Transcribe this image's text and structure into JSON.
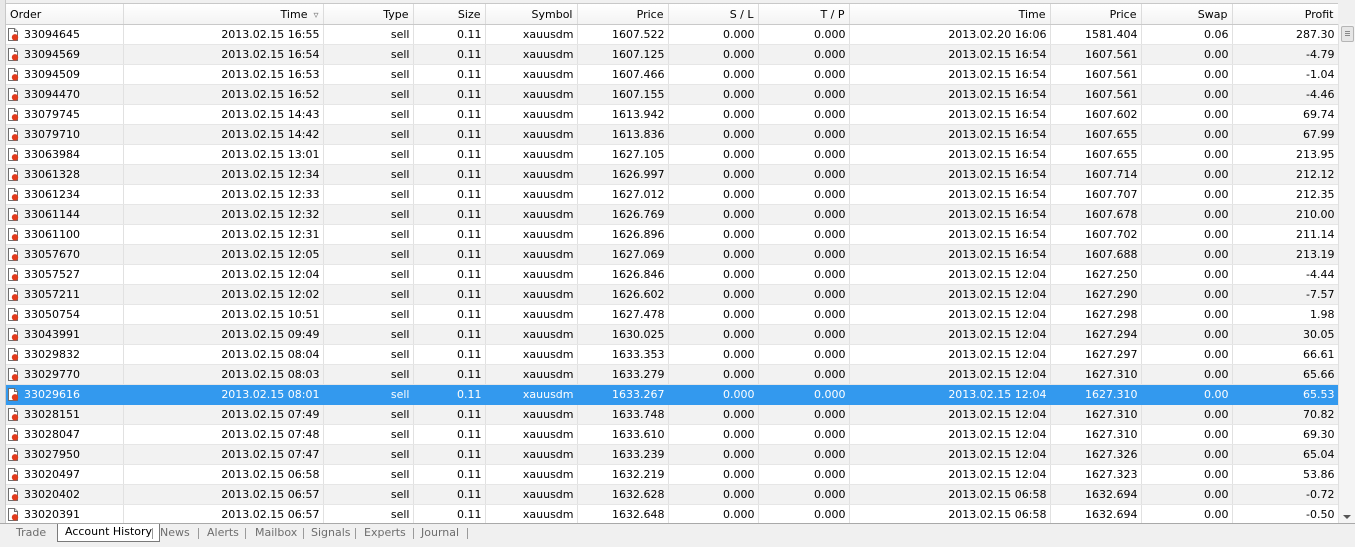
{
  "columns": [
    "Order",
    "Time",
    "Type",
    "Size",
    "Symbol",
    "Price",
    "S / L",
    "T / P",
    "Time",
    "Price",
    "Swap",
    "Profit"
  ],
  "sort_column": "Time",
  "selected_order": "33029616",
  "rows": [
    [
      "33094645",
      "2013.02.15 16:55",
      "sell",
      "0.11",
      "xauusdm",
      "1607.522",
      "0.000",
      "0.000",
      "2013.02.20 16:06",
      "1581.404",
      "0.06",
      "287.30"
    ],
    [
      "33094569",
      "2013.02.15 16:54",
      "sell",
      "0.11",
      "xauusdm",
      "1607.125",
      "0.000",
      "0.000",
      "2013.02.15 16:54",
      "1607.561",
      "0.00",
      "-4.79"
    ],
    [
      "33094509",
      "2013.02.15 16:53",
      "sell",
      "0.11",
      "xauusdm",
      "1607.466",
      "0.000",
      "0.000",
      "2013.02.15 16:54",
      "1607.561",
      "0.00",
      "-1.04"
    ],
    [
      "33094470",
      "2013.02.15 16:52",
      "sell",
      "0.11",
      "xauusdm",
      "1607.155",
      "0.000",
      "0.000",
      "2013.02.15 16:54",
      "1607.561",
      "0.00",
      "-4.46"
    ],
    [
      "33079745",
      "2013.02.15 14:43",
      "sell",
      "0.11",
      "xauusdm",
      "1613.942",
      "0.000",
      "0.000",
      "2013.02.15 16:54",
      "1607.602",
      "0.00",
      "69.74"
    ],
    [
      "33079710",
      "2013.02.15 14:42",
      "sell",
      "0.11",
      "xauusdm",
      "1613.836",
      "0.000",
      "0.000",
      "2013.02.15 16:54",
      "1607.655",
      "0.00",
      "67.99"
    ],
    [
      "33063984",
      "2013.02.15 13:01",
      "sell",
      "0.11",
      "xauusdm",
      "1627.105",
      "0.000",
      "0.000",
      "2013.02.15 16:54",
      "1607.655",
      "0.00",
      "213.95"
    ],
    [
      "33061328",
      "2013.02.15 12:34",
      "sell",
      "0.11",
      "xauusdm",
      "1626.997",
      "0.000",
      "0.000",
      "2013.02.15 16:54",
      "1607.714",
      "0.00",
      "212.12"
    ],
    [
      "33061234",
      "2013.02.15 12:33",
      "sell",
      "0.11",
      "xauusdm",
      "1627.012",
      "0.000",
      "0.000",
      "2013.02.15 16:54",
      "1607.707",
      "0.00",
      "212.35"
    ],
    [
      "33061144",
      "2013.02.15 12:32",
      "sell",
      "0.11",
      "xauusdm",
      "1626.769",
      "0.000",
      "0.000",
      "2013.02.15 16:54",
      "1607.678",
      "0.00",
      "210.00"
    ],
    [
      "33061100",
      "2013.02.15 12:31",
      "sell",
      "0.11",
      "xauusdm",
      "1626.896",
      "0.000",
      "0.000",
      "2013.02.15 16:54",
      "1607.702",
      "0.00",
      "211.14"
    ],
    [
      "33057670",
      "2013.02.15 12:05",
      "sell",
      "0.11",
      "xauusdm",
      "1627.069",
      "0.000",
      "0.000",
      "2013.02.15 16:54",
      "1607.688",
      "0.00",
      "213.19"
    ],
    [
      "33057527",
      "2013.02.15 12:04",
      "sell",
      "0.11",
      "xauusdm",
      "1626.846",
      "0.000",
      "0.000",
      "2013.02.15 12:04",
      "1627.250",
      "0.00",
      "-4.44"
    ],
    [
      "33057211",
      "2013.02.15 12:02",
      "sell",
      "0.11",
      "xauusdm",
      "1626.602",
      "0.000",
      "0.000",
      "2013.02.15 12:04",
      "1627.290",
      "0.00",
      "-7.57"
    ],
    [
      "33050754",
      "2013.02.15 10:51",
      "sell",
      "0.11",
      "xauusdm",
      "1627.478",
      "0.000",
      "0.000",
      "2013.02.15 12:04",
      "1627.298",
      "0.00",
      "1.98"
    ],
    [
      "33043991",
      "2013.02.15 09:49",
      "sell",
      "0.11",
      "xauusdm",
      "1630.025",
      "0.000",
      "0.000",
      "2013.02.15 12:04",
      "1627.294",
      "0.00",
      "30.05"
    ],
    [
      "33029832",
      "2013.02.15 08:04",
      "sell",
      "0.11",
      "xauusdm",
      "1633.353",
      "0.000",
      "0.000",
      "2013.02.15 12:04",
      "1627.297",
      "0.00",
      "66.61"
    ],
    [
      "33029770",
      "2013.02.15 08:03",
      "sell",
      "0.11",
      "xauusdm",
      "1633.279",
      "0.000",
      "0.000",
      "2013.02.15 12:04",
      "1627.310",
      "0.00",
      "65.66"
    ],
    [
      "33029616",
      "2013.02.15 08:01",
      "sell",
      "0.11",
      "xauusdm",
      "1633.267",
      "0.000",
      "0.000",
      "2013.02.15 12:04",
      "1627.310",
      "0.00",
      "65.53"
    ],
    [
      "33028151",
      "2013.02.15 07:49",
      "sell",
      "0.11",
      "xauusdm",
      "1633.748",
      "0.000",
      "0.000",
      "2013.02.15 12:04",
      "1627.310",
      "0.00",
      "70.82"
    ],
    [
      "33028047",
      "2013.02.15 07:48",
      "sell",
      "0.11",
      "xauusdm",
      "1633.610",
      "0.000",
      "0.000",
      "2013.02.15 12:04",
      "1627.310",
      "0.00",
      "69.30"
    ],
    [
      "33027950",
      "2013.02.15 07:47",
      "sell",
      "0.11",
      "xauusdm",
      "1633.239",
      "0.000",
      "0.000",
      "2013.02.15 12:04",
      "1627.326",
      "0.00",
      "65.04"
    ],
    [
      "33020497",
      "2013.02.15 06:58",
      "sell",
      "0.11",
      "xauusdm",
      "1632.219",
      "0.000",
      "0.000",
      "2013.02.15 12:04",
      "1627.323",
      "0.00",
      "53.86"
    ],
    [
      "33020402",
      "2013.02.15 06:57",
      "sell",
      "0.11",
      "xauusdm",
      "1632.628",
      "0.000",
      "0.000",
      "2013.02.15 06:58",
      "1632.694",
      "0.00",
      "-0.72"
    ],
    [
      "33020391",
      "2013.02.15 06:57",
      "sell",
      "0.11",
      "xauusdm",
      "1632.648",
      "0.000",
      "0.000",
      "2013.02.15 06:58",
      "1632.694",
      "0.00",
      "-0.50"
    ]
  ],
  "tabs": [
    {
      "label": "Trade",
      "active": false
    },
    {
      "label": "Account History",
      "active": true
    },
    {
      "label": "News",
      "active": false
    },
    {
      "label": "Alerts",
      "active": false
    },
    {
      "label": "Mailbox",
      "active": false
    },
    {
      "label": "Signals",
      "active": false
    },
    {
      "label": "Experts",
      "active": false
    },
    {
      "label": "Journal",
      "active": false
    }
  ],
  "colors": {
    "selected_row": "#3399ee",
    "alt_row": "#f2f2f2",
    "icon_dot": "#e03c1e"
  },
  "icons": {
    "row_icon": "sell-order-document-icon",
    "sort_icon": "sort-descending-icon"
  }
}
